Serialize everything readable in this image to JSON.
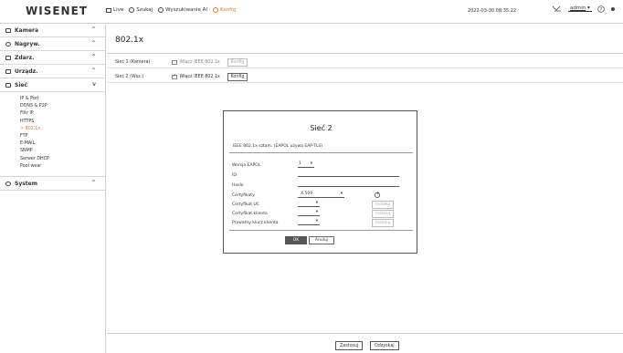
{
  "logo": "WISENET",
  "topmenu": [
    {
      "label": "Live",
      "icon": "monitor-icon",
      "active": false
    },
    {
      "label": "Szukaj",
      "icon": "search-icon",
      "active": false
    },
    {
      "label": "Wyszukiwanie AI",
      "icon": "ai-search-icon",
      "active": false
    },
    {
      "label": "Konfig",
      "icon": "gear-icon",
      "active": true
    }
  ],
  "datetime": "2022-03-30 08:35:22",
  "user": "admin",
  "sidebar": {
    "sections": [
      {
        "label": "Kamera",
        "icon": "camera-icon"
      },
      {
        "label": "Nagryw.",
        "icon": "record-icon"
      },
      {
        "label": "Zdarz.",
        "icon": "event-icon"
      },
      {
        "label": "Urządz.",
        "icon": "device-icon"
      },
      {
        "label": "Sieć",
        "icon": "network-icon"
      },
      {
        "label": "System",
        "icon": "gear-icon"
      }
    ],
    "network_items": [
      "IP & Port",
      "DDNS & P2P",
      "Filtr IP",
      "HTTPS",
      "802.1x",
      "FTP",
      "E-MAIL",
      "SNMP",
      "Serwer DHCP",
      "Pool wear"
    ]
  },
  "page_title": "802.1x",
  "rows": [
    {
      "label": "Sieć 1 (Kamera)",
      "checkbox_label": "Włącz IEEE 802.1x",
      "checked": false,
      "button": "Konfig"
    },
    {
      "label": "Sieć 2 (Wsz.)",
      "checkbox_label": "Włącz IEEE 802.1x",
      "checked": true,
      "button": "Konfig"
    }
  ],
  "modal": {
    "title": "Sieć 2",
    "desc": "IEEE 802.1x sztam. (EAPOL używa EAP-TLS)",
    "fields": {
      "eapol_label": "Wersja EAPOL",
      "eapol_value": "1",
      "id_label": "ID",
      "password_label": "Hasło",
      "certs_label": "Certyfikaty",
      "certs_value": "X.509",
      "ca_label": "Certyfikat UC",
      "client_label": "Certyfikat klienta",
      "key_label": "Prywatny klucz klienta",
      "install": "Instaluj"
    },
    "ok": "OK",
    "cancel": "Anuluj"
  },
  "footer": {
    "apply": "Zastosuj",
    "cancel": "Odzyskaj"
  }
}
